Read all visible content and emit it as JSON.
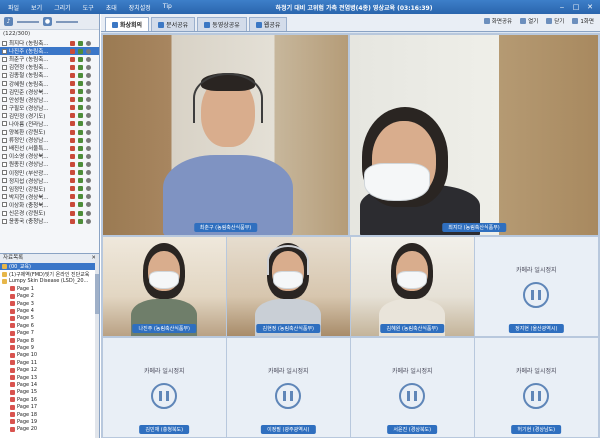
{
  "window": {
    "menu": [
      "파일",
      "보기",
      "그리기",
      "도구",
      "초대",
      "장치설정",
      "Tip"
    ],
    "title": "하정기 대비 고위험 가축 전염병(4종) 영상교육 (03:16:39)"
  },
  "left_panel": {
    "user_count": "(122/300)",
    "users": [
      {
        "name": "최지다 (농림축..."
      },
      {
        "name": "나진주 (농림축..."
      },
      {
        "name": "최춘구 (농림축..."
      },
      {
        "name": "김현정 (농림축..."
      },
      {
        "name": "김종철 (농림축..."
      },
      {
        "name": "강혜원 (농림축..."
      },
      {
        "name": "김민준 (경상북..."
      },
      {
        "name": "안성원 (경상남..."
      },
      {
        "name": "구필모 (경상남..."
      },
      {
        "name": "김민정 (경기도)"
      },
      {
        "name": "나아름 (전라남..."
      },
      {
        "name": "양복환 (강원도)"
      },
      {
        "name": "류정인 (경상남..."
      },
      {
        "name": "배진선 (서울특..."
      },
      {
        "name": "이소영 (경상북..."
      },
      {
        "name": "원종진 (경상남..."
      },
      {
        "name": "이정민 (부산광..."
      },
      {
        "name": "정지섭 (경상남..."
      },
      {
        "name": "임정민 (강원도)"
      },
      {
        "name": "박지현 (경상북..."
      },
      {
        "name": "이상화 (충청북..."
      },
      {
        "name": "신은경 (강원도)"
      },
      {
        "name": "윤종국 (충청남..."
      }
    ],
    "materials_header": "자료목록",
    "materials": [
      {
        "name": "(00_교육)",
        "type": "folder",
        "indent": false,
        "highlight": true
      },
      {
        "name": "(1)구제역(FMD)및기 온라인 진단교육",
        "type": "folder",
        "indent": false,
        "highlight": false
      },
      {
        "name": "Lumpy Skin Disease (LSD)_20...",
        "type": "folder",
        "indent": false,
        "highlight": false
      },
      {
        "name": "Page 1",
        "type": "page",
        "indent": true,
        "highlight": false
      },
      {
        "name": "Page 2",
        "type": "page",
        "indent": true,
        "highlight": false
      },
      {
        "name": "Page 3",
        "type": "page",
        "indent": true,
        "highlight": false
      },
      {
        "name": "Page 4",
        "type": "page",
        "indent": true,
        "highlight": false
      },
      {
        "name": "Page 5",
        "type": "page",
        "indent": true,
        "highlight": false
      },
      {
        "name": "Page 6",
        "type": "page",
        "indent": true,
        "highlight": false
      },
      {
        "name": "Page 7",
        "type": "page",
        "indent": true,
        "highlight": false
      },
      {
        "name": "Page 8",
        "type": "page",
        "indent": true,
        "highlight": false
      },
      {
        "name": "Page 9",
        "type": "page",
        "indent": true,
        "highlight": false
      },
      {
        "name": "Page 10",
        "type": "page",
        "indent": true,
        "highlight": false
      },
      {
        "name": "Page 11",
        "type": "page",
        "indent": true,
        "highlight": false
      },
      {
        "name": "Page 12",
        "type": "page",
        "indent": true,
        "highlight": false
      },
      {
        "name": "Page 13",
        "type": "page",
        "indent": true,
        "highlight": false
      },
      {
        "name": "Page 14",
        "type": "page",
        "indent": true,
        "highlight": false
      },
      {
        "name": "Page 15",
        "type": "page",
        "indent": true,
        "highlight": false
      },
      {
        "name": "Page 16",
        "type": "page",
        "indent": true,
        "highlight": false
      },
      {
        "name": "Page 17",
        "type": "page",
        "indent": true,
        "highlight": false
      },
      {
        "name": "Page 18",
        "type": "page",
        "indent": true,
        "highlight": false
      },
      {
        "name": "Page 19",
        "type": "page",
        "indent": true,
        "highlight": false
      },
      {
        "name": "Page 20",
        "type": "page",
        "indent": true,
        "highlight": false
      }
    ]
  },
  "tabs": [
    {
      "label": "화상회의",
      "active": true
    },
    {
      "label": "문서공유",
      "active": false
    },
    {
      "label": "동영상공유",
      "active": false
    },
    {
      "label": "웹공유",
      "active": false
    }
  ],
  "right_tools": [
    "화면공유",
    "열기",
    "닫기",
    "1화면"
  ],
  "video_grid": {
    "main_speaker": "최춘구 (농림축산식품부)",
    "second_speaker": "최지다 (농림축산식품부)",
    "row2": [
      {
        "label": "나진주 (농림축산식품부)",
        "paused": false
      },
      {
        "label": "김현정 (농림축산식품부)",
        "paused": false
      },
      {
        "label": "김혜원 (농림축산식품부)",
        "paused": false
      },
      {
        "label": "정지현 (울산광역시)",
        "paused": true
      }
    ],
    "row3": [
      {
        "label": "김민재 (충청북도)",
        "paused": true
      },
      {
        "label": "이정필 (광주광역시)",
        "paused": true
      },
      {
        "label": "서윤진 (경상북도)",
        "paused": true
      },
      {
        "label": "허기현 (경상남도)",
        "paused": true
      }
    ],
    "paused_text": "카메라 일시정지"
  },
  "colors": {
    "titlebar": "#2f6fbf",
    "selection": "#3a76c8",
    "label_bg": "#2f6fbf"
  }
}
